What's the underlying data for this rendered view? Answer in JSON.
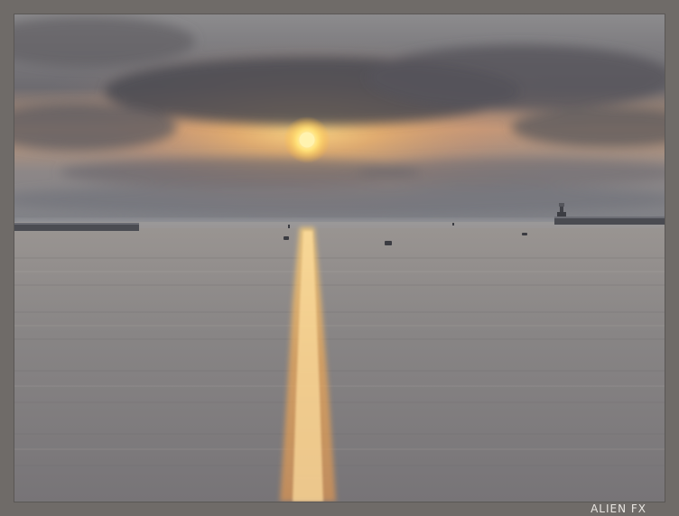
{
  "image": {
    "signature": "ALIEN FX",
    "colors": {
      "frame": "#6f6b68",
      "sky_top": "#8a8a8c",
      "sun": "#ffd24a",
      "glow": "#f0b46a",
      "sea": "#8f8c8c",
      "reflection": "#f2b15a"
    }
  }
}
